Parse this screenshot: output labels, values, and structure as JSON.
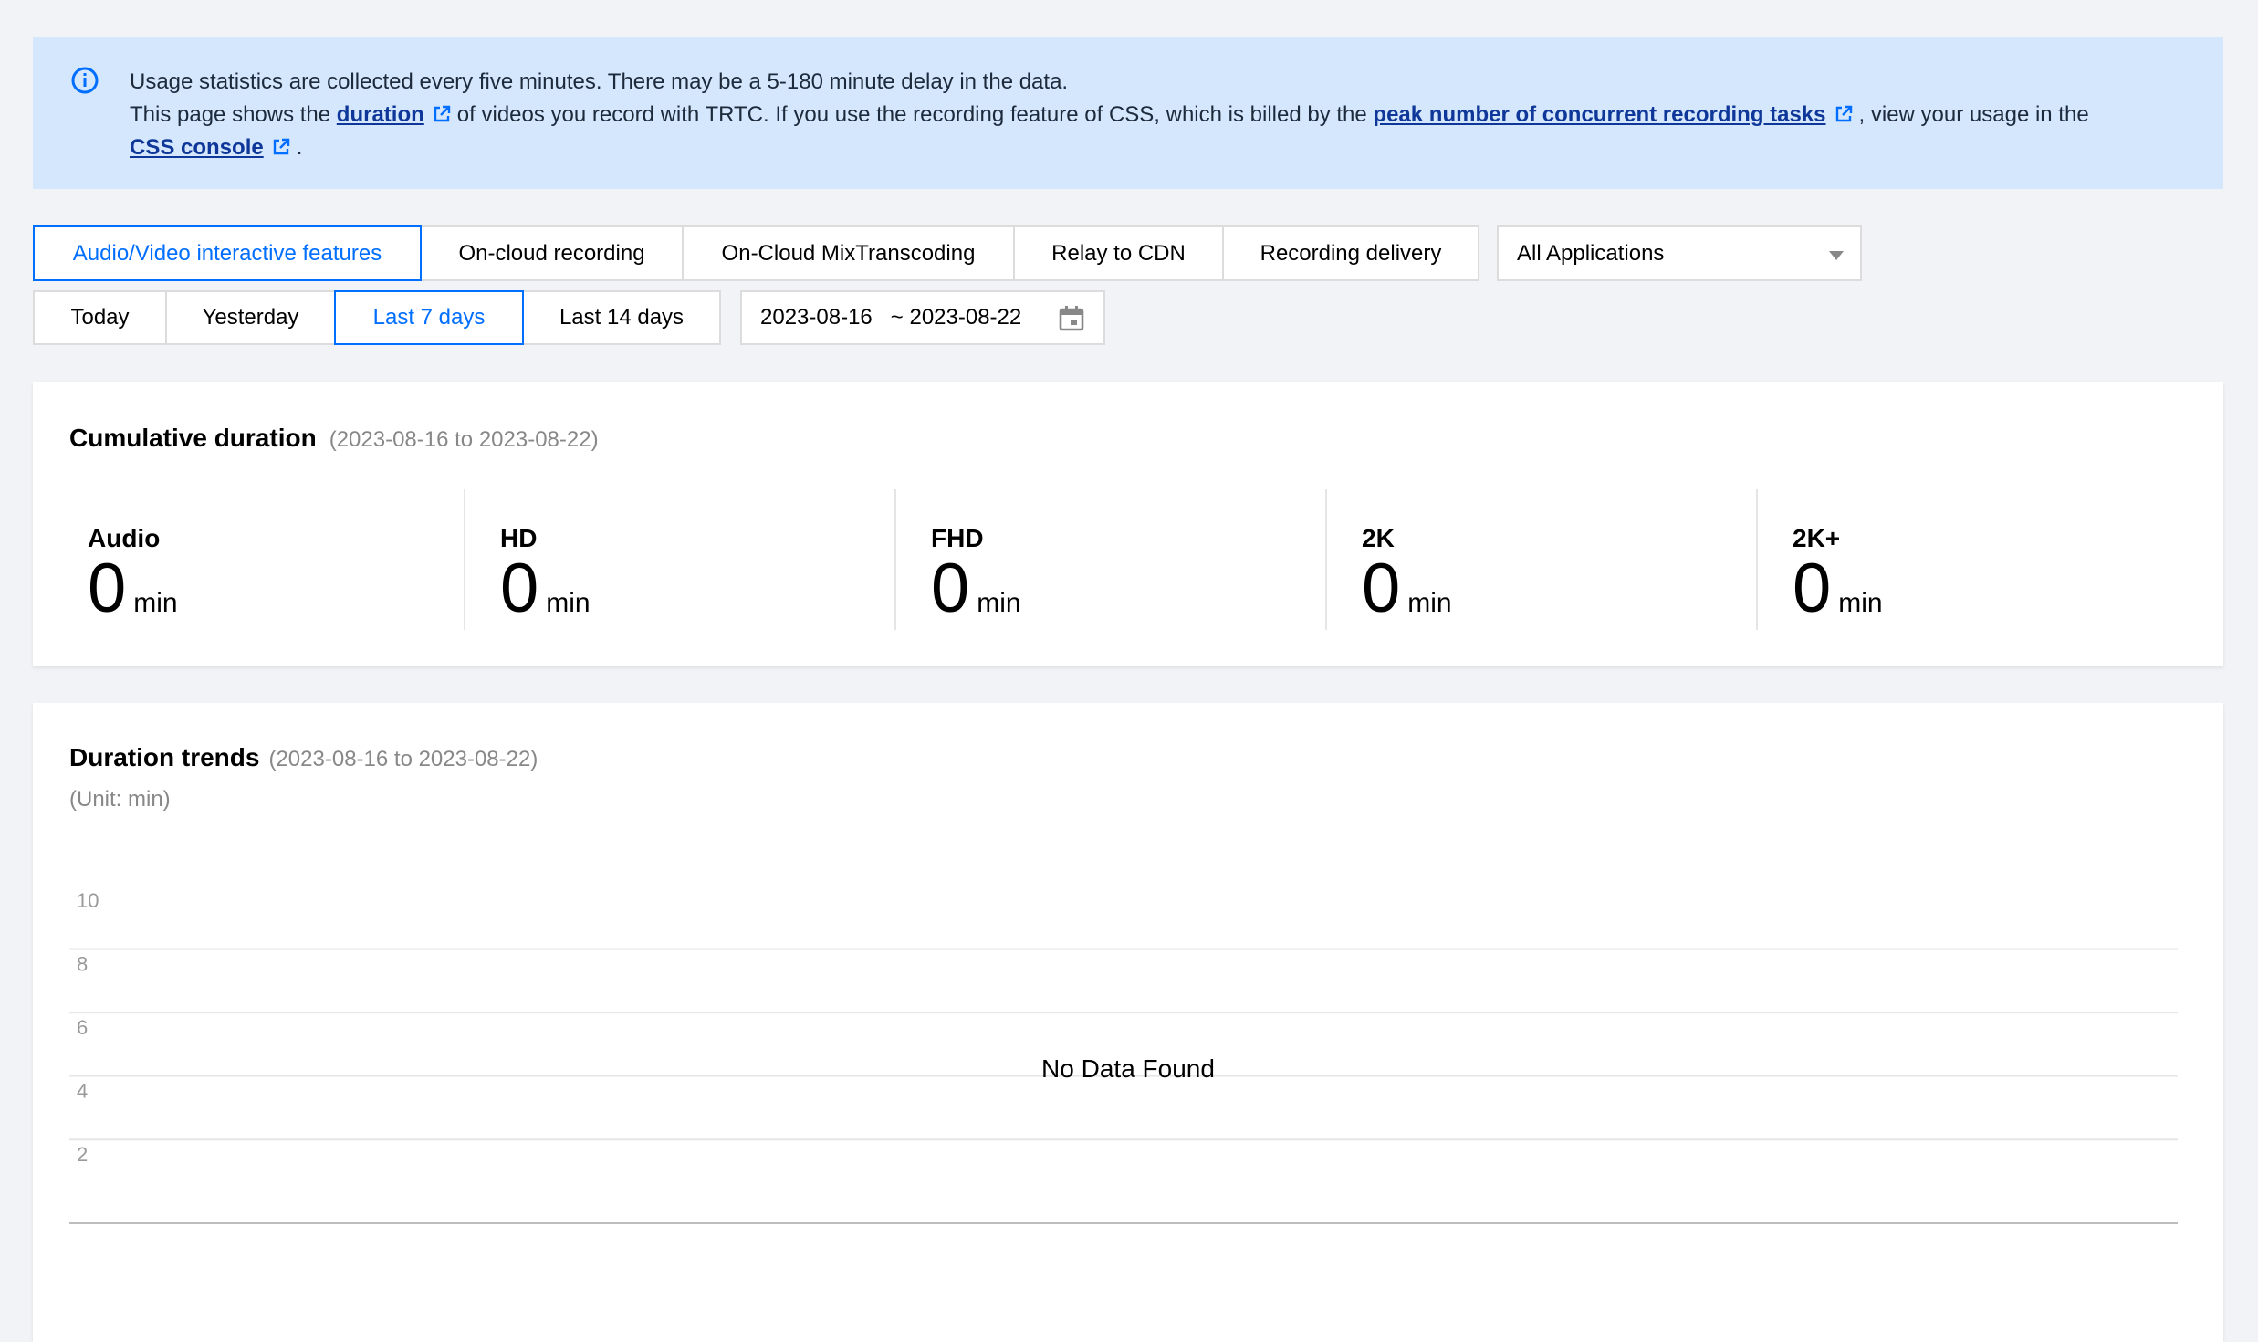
{
  "notice": {
    "line1": "Usage statistics are collected every five minutes. There may be a 5-180 minute delay in the data.",
    "line2_a": "This page shows the",
    "line2_link1": "duration",
    "line2_b": "of videos you record with TRTC. If you use the recording feature of CSS, which is billed by the",
    "line2_link2": "peak number of concurrent recording tasks",
    "line2_c": ", view your usage in the",
    "line3_link": "CSS console",
    "line3_end": "."
  },
  "feature_tabs": [
    {
      "label": "Audio/Video interactive features",
      "active": true
    },
    {
      "label": "On-cloud recording",
      "active": false
    },
    {
      "label": "On-Cloud MixTranscoding",
      "active": false
    },
    {
      "label": "Relay to CDN",
      "active": false
    },
    {
      "label": "Recording delivery",
      "active": false
    }
  ],
  "app_select": {
    "value": "All Applications"
  },
  "date_tabs": [
    {
      "label": "Today",
      "active": false
    },
    {
      "label": "Yesterday",
      "active": false
    },
    {
      "label": "Last 7 days",
      "active": true
    },
    {
      "label": "Last 14 days",
      "active": false
    }
  ],
  "date_range": {
    "start": "2023-08-16",
    "end": "2023-08-22",
    "separator": "~"
  },
  "cumulative": {
    "title": "Cumulative duration",
    "subtitle": "(2023-08-16 to 2023-08-22)",
    "metrics": [
      {
        "label": "Audio",
        "value": "0",
        "unit": "min"
      },
      {
        "label": "HD",
        "value": "0",
        "unit": "min"
      },
      {
        "label": "FHD",
        "value": "0",
        "unit": "min"
      },
      {
        "label": "2K",
        "value": "0",
        "unit": "min"
      },
      {
        "label": "2K+",
        "value": "0",
        "unit": "min"
      }
    ]
  },
  "trends": {
    "title": "Duration trends",
    "subtitle": "(2023-08-16 to 2023-08-22)",
    "unit": "(Unit: min)",
    "empty_text": "No Data Found"
  },
  "chart_data": {
    "type": "line",
    "series": [],
    "y_ticks": [
      "10",
      "8",
      "6",
      "4",
      "2"
    ],
    "ylim": [
      0,
      10
    ],
    "grid": true,
    "empty_text": "No Data Found"
  },
  "colors": {
    "accent": "#006eff",
    "notice_bg": "#d5e7fd",
    "link": "#0e3799"
  }
}
